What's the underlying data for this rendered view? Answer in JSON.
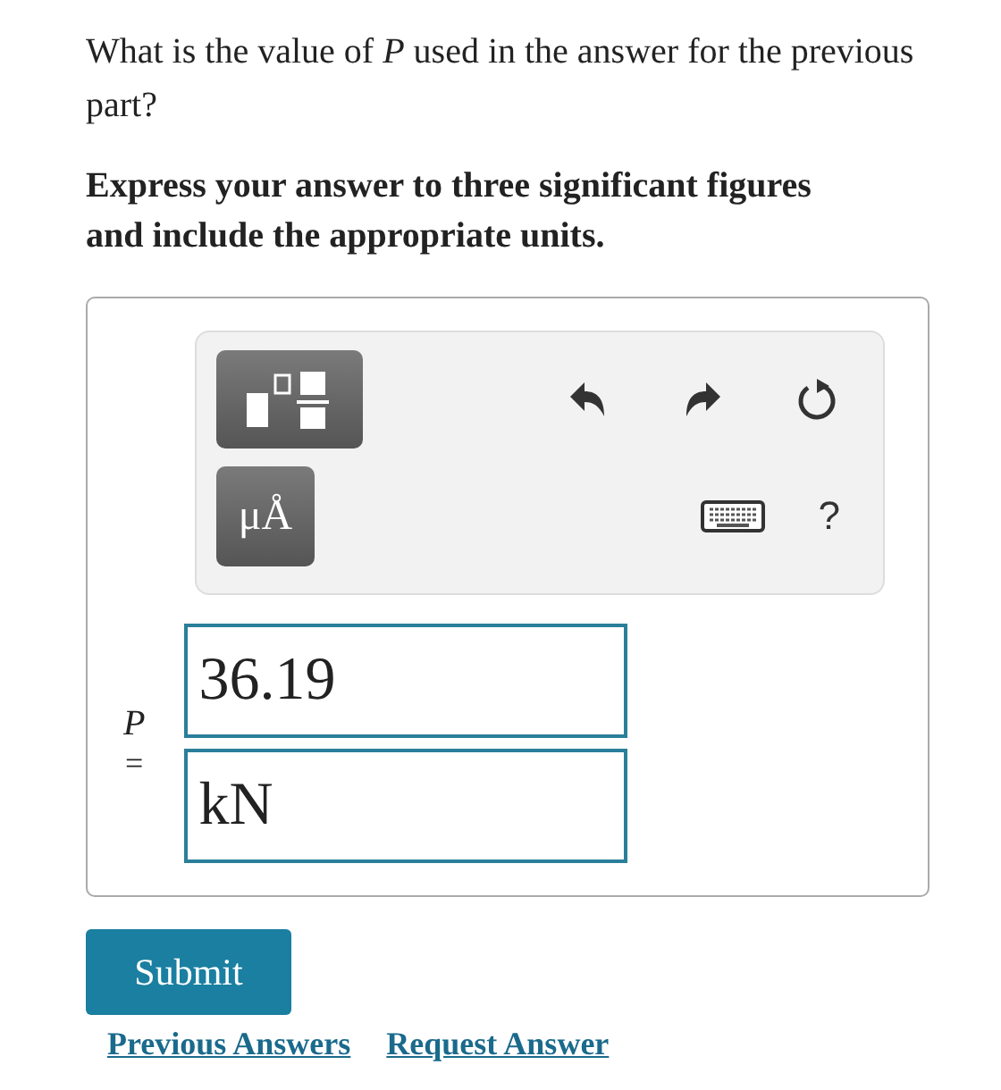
{
  "question": "What is the value of *P* used in the answer for the previous part?",
  "instruction": "Express your answer to three significant figures and include the appropriate units.",
  "toolbar": {
    "units_button": "μÅ",
    "help": "?"
  },
  "answer": {
    "variable": "P",
    "equals": "=",
    "value": "36.19",
    "units": "kN"
  },
  "submit": "Submit",
  "links": [
    "Previous Answers",
    "Request Answer"
  ]
}
